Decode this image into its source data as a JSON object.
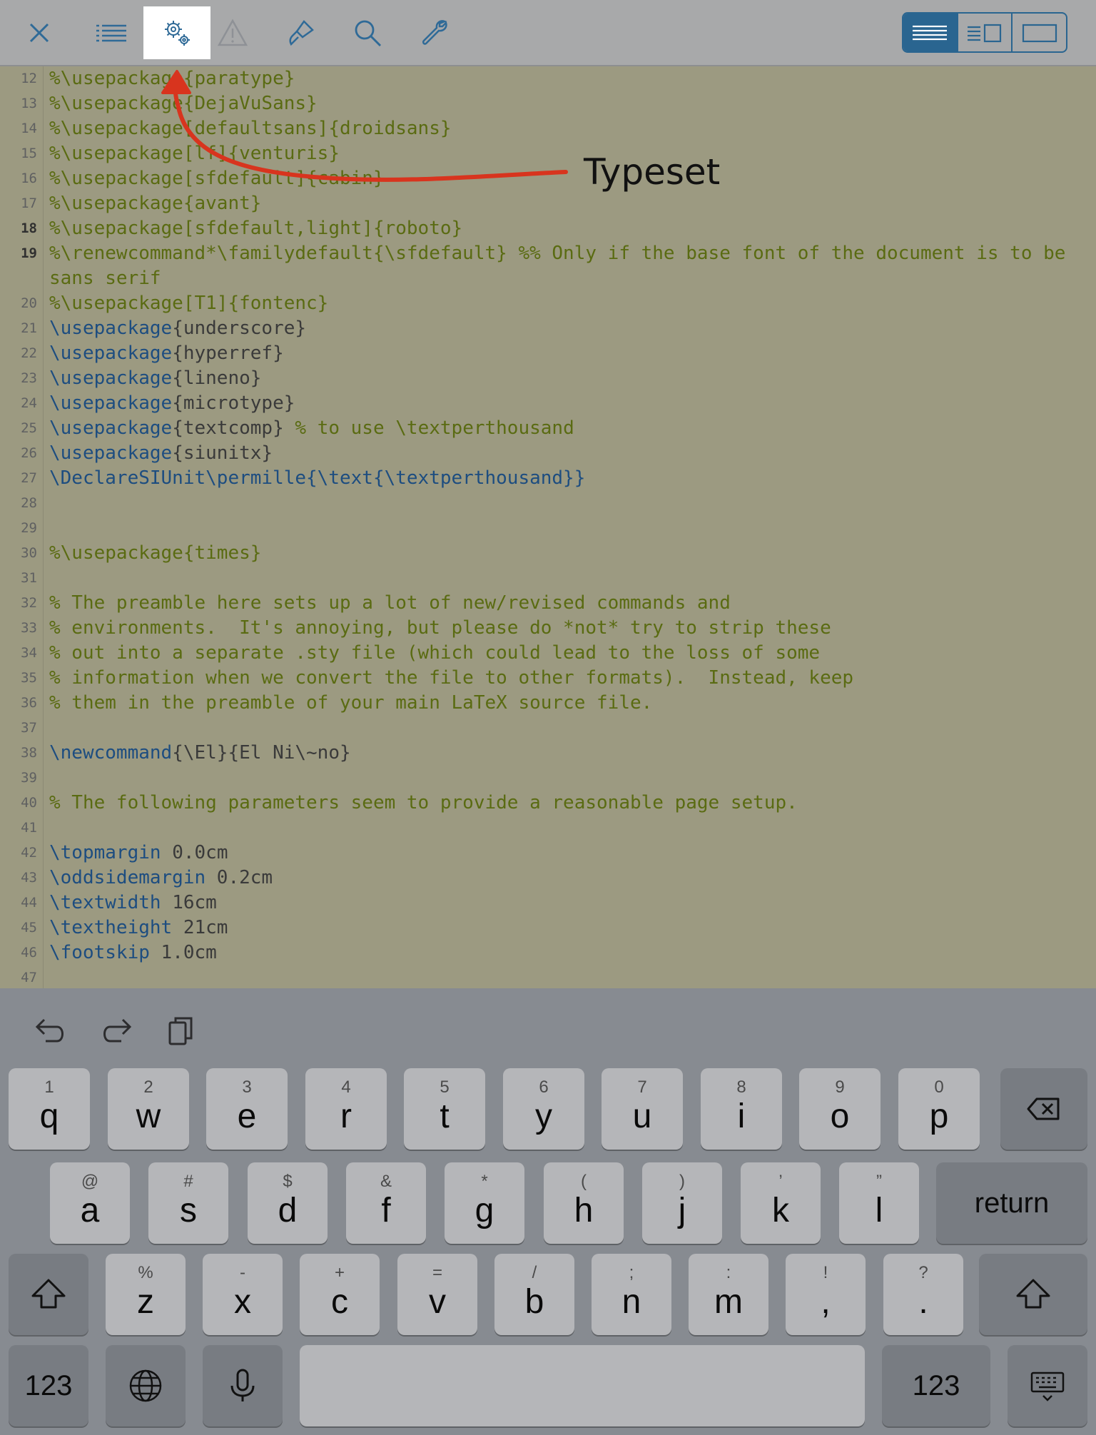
{
  "toolbar": {
    "buttons": [
      {
        "icon": "close-icon",
        "name": "close"
      },
      {
        "icon": "list-icon",
        "name": "outline"
      },
      {
        "icon": "gears-icon",
        "name": "typeset",
        "active": true
      },
      {
        "icon": "warning-icon",
        "name": "warnings"
      },
      {
        "icon": "brush-icon",
        "name": "format"
      },
      {
        "icon": "search-icon",
        "name": "search"
      },
      {
        "icon": "wrench-icon",
        "name": "tools"
      }
    ],
    "view_modes": [
      "editor-only",
      "split",
      "preview-only"
    ],
    "active_view": "editor-only",
    "accent_color": "#2a6590"
  },
  "editor": {
    "lines": [
      {
        "n": "12",
        "text": "%\\usepackage{paratype}",
        "kind": "comment"
      },
      {
        "n": "13",
        "text": "%\\usepackage{DejaVuSans}",
        "kind": "comment"
      },
      {
        "n": "14",
        "text": "%\\usepackage[defaultsans]{droidsans}",
        "kind": "comment"
      },
      {
        "n": "15",
        "text": "%\\usepackage[lf]{venturis}",
        "kind": "comment"
      },
      {
        "n": "16",
        "text": "%\\usepackage[sfdefault]{cabin}",
        "kind": "comment"
      },
      {
        "n": "17",
        "text": "%\\usepackage{avant}",
        "kind": "comment"
      },
      {
        "n": "18",
        "text": "%\\usepackage[sfdefault,light]{roboto}",
        "kind": "comment"
      },
      {
        "n": "19",
        "text": "%\\renewcommand*\\familydefault{\\sfdefault} %% Only if the base font of the document is to be sans serif",
        "kind": "comment"
      },
      {
        "n": "20",
        "text": "%\\usepackage[T1]{fontenc}",
        "kind": "comment"
      },
      {
        "n": "21",
        "cmd": "\\usepackage",
        "rest": "{underscore}"
      },
      {
        "n": "22",
        "cmd": "\\usepackage",
        "rest": "{hyperref}"
      },
      {
        "n": "23",
        "cmd": "\\usepackage",
        "rest": "{lineno}"
      },
      {
        "n": "24",
        "cmd": "\\usepackage",
        "rest": "{microtype}"
      },
      {
        "n": "25",
        "cmd": "\\usepackage",
        "rest": "{textcomp}",
        "comment": " % to use \\textperthousand"
      },
      {
        "n": "26",
        "cmd": "\\usepackage",
        "rest": "{siunitx}"
      },
      {
        "n": "27",
        "text": "\\DeclareSIUnit\\permille{\\text{\\textperthousand}}",
        "kind": "command"
      },
      {
        "n": "28",
        "text": ""
      },
      {
        "n": "29",
        "text": ""
      },
      {
        "n": "30",
        "text": "%\\usepackage{times}",
        "kind": "comment"
      },
      {
        "n": "31",
        "text": ""
      },
      {
        "n": "32",
        "text": "% The preamble here sets up a lot of new/revised commands and",
        "kind": "comment"
      },
      {
        "n": "33",
        "text": "% environments.  It's annoying, but please do *not* try to strip these",
        "kind": "comment"
      },
      {
        "n": "34",
        "text": "% out into a separate .sty file (which could lead to the loss of some",
        "kind": "comment"
      },
      {
        "n": "35",
        "text": "% information when we convert the file to other formats).  Instead, keep",
        "kind": "comment"
      },
      {
        "n": "36",
        "text": "% them in the preamble of your main LaTeX source file.",
        "kind": "comment"
      },
      {
        "n": "37",
        "text": ""
      },
      {
        "n": "38",
        "cmd": "\\newcommand",
        "rest": "{\\El}{El Ni\\~no}"
      },
      {
        "n": "39",
        "text": ""
      },
      {
        "n": "40",
        "text": "% The following parameters seem to provide a reasonable page setup.",
        "kind": "comment"
      },
      {
        "n": "41",
        "text": ""
      },
      {
        "n": "42",
        "cmd": "\\topmargin",
        "rest": " 0.0cm"
      },
      {
        "n": "43",
        "cmd": "\\oddsidemargin",
        "rest": " 0.2cm"
      },
      {
        "n": "44",
        "cmd": "\\textwidth",
        "rest": " 16cm"
      },
      {
        "n": "45",
        "cmd": "\\textheight",
        "rest": " 21cm"
      },
      {
        "n": "46",
        "cmd": "\\footskip",
        "rest": " 1.0cm"
      },
      {
        "n": "47",
        "text": ""
      }
    ]
  },
  "annotation": {
    "label": "Typeset",
    "arrow_color": "#d8341e"
  },
  "accessory_bar": {
    "icons": [
      "undo-icon",
      "redo-icon",
      "paste-icon"
    ]
  },
  "keyboard": {
    "row1": [
      {
        "sub": "1",
        "main": "q"
      },
      {
        "sub": "2",
        "main": "w"
      },
      {
        "sub": "3",
        "main": "e"
      },
      {
        "sub": "4",
        "main": "r"
      },
      {
        "sub": "5",
        "main": "t"
      },
      {
        "sub": "6",
        "main": "y"
      },
      {
        "sub": "7",
        "main": "u"
      },
      {
        "sub": "8",
        "main": "i"
      },
      {
        "sub": "9",
        "main": "o"
      },
      {
        "sub": "0",
        "main": "p"
      }
    ],
    "row2": [
      {
        "sub": "@",
        "main": "a"
      },
      {
        "sub": "#",
        "main": "s"
      },
      {
        "sub": "$",
        "main": "d"
      },
      {
        "sub": "&",
        "main": "f"
      },
      {
        "sub": "*",
        "main": "g"
      },
      {
        "sub": "(",
        "main": "h"
      },
      {
        "sub": ")",
        "main": "j"
      },
      {
        "sub": "’",
        "main": "k"
      },
      {
        "sub": "”",
        "main": "l"
      }
    ],
    "row3": [
      {
        "sub": "%",
        "main": "z"
      },
      {
        "sub": "-",
        "main": "x"
      },
      {
        "sub": "+",
        "main": "c"
      },
      {
        "sub": "=",
        "main": "v"
      },
      {
        "sub": "/",
        "main": "b"
      },
      {
        "sub": ";",
        "main": "n"
      },
      {
        "sub": ":",
        "main": "m"
      },
      {
        "sub": "!",
        "main": ","
      },
      {
        "sub": "?",
        "main": "."
      }
    ],
    "return_label": "return",
    "numbers_label": "123"
  }
}
